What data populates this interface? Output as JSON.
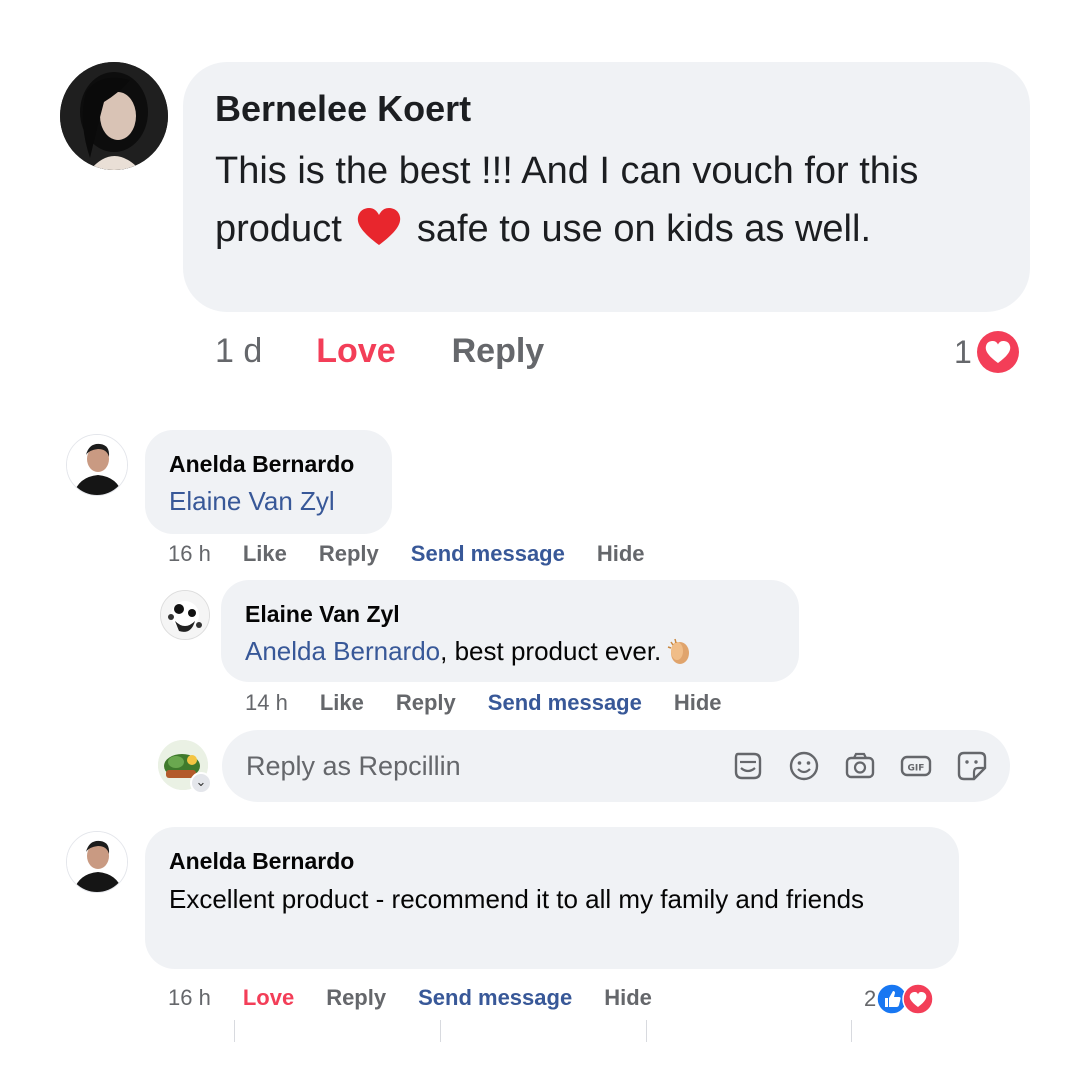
{
  "comments": [
    {
      "author": "Bernelee Koert",
      "text_before": "This is the best !!! And I can vouch for this product ",
      "text_emoji": "red-heart",
      "text_after": " safe to use on kids as well.",
      "time": "1 d",
      "reaction_label": "Love",
      "reply_label": "Reply",
      "reaction_count": "1",
      "reaction_icon": "love-reaction-icon"
    },
    {
      "author": "Anelda Bernardo",
      "mention": "Elaine Van Zyl",
      "time": "16 h",
      "like_label": "Like",
      "reply_label": "Reply",
      "send_label": "Send message",
      "hide_label": "Hide",
      "reply": {
        "author": "Elaine Van Zyl",
        "mention": "Anelda Bernardo",
        "text": ", best product ever.",
        "emoji": "clapping-hands",
        "time": "14 h",
        "like_label": "Like",
        "reply_label": "Reply",
        "send_label": "Send message",
        "hide_label": "Hide"
      }
    },
    {
      "author": "Anelda Bernardo",
      "text": "Excellent product - recommend it to all my family and friends",
      "time": "16 h",
      "reaction_label": "Love",
      "reply_label": "Reply",
      "send_label": "Send message",
      "hide_label": "Hide",
      "reaction_count": "2",
      "reaction_icons": [
        "like-reaction-icon",
        "love-reaction-icon"
      ]
    }
  ],
  "reply_input": {
    "placeholder": "Reply as Repcillin",
    "tools": [
      "avatar-sticker-icon",
      "emoji-icon",
      "camera-icon",
      "gif-icon",
      "sticker-icon"
    ]
  },
  "colors": {
    "bubble": "#f0f2f5",
    "mention": "#385898",
    "love": "#f33e58",
    "like": "#1877f2",
    "meta": "#65676b"
  }
}
